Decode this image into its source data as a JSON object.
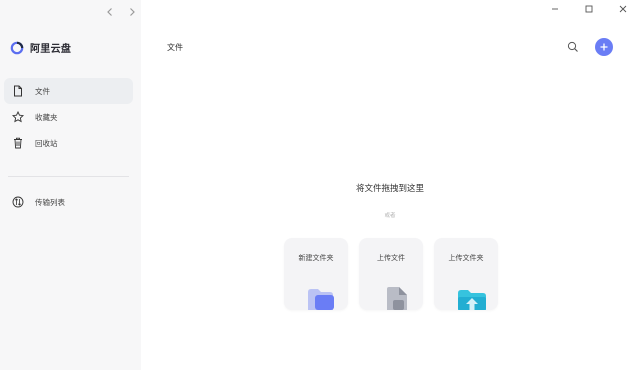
{
  "app": {
    "name": "阿里云盘"
  },
  "sidebar": {
    "items": [
      {
        "label": "文件",
        "active": true,
        "icon": "file-icon"
      },
      {
        "label": "收藏夹",
        "active": false,
        "icon": "star-icon"
      },
      {
        "label": "回收站",
        "active": false,
        "icon": "trash-icon"
      }
    ],
    "transfer": {
      "label": "传输列表",
      "icon": "transfer-icon"
    }
  },
  "header": {
    "title": "文件"
  },
  "dropzone": {
    "title": "将文件拖拽到这里",
    "subtitle": "或者",
    "cards": [
      {
        "label": "新建文件夹",
        "icon": "new-folder-icon"
      },
      {
        "label": "上传文件",
        "icon": "upload-file-icon"
      },
      {
        "label": "上传文件夹",
        "icon": "upload-folder-icon"
      }
    ]
  },
  "colors": {
    "accent": "#6a7df5",
    "sidebar_bg": "#f7f7f8",
    "active_bg": "#eceef1"
  }
}
